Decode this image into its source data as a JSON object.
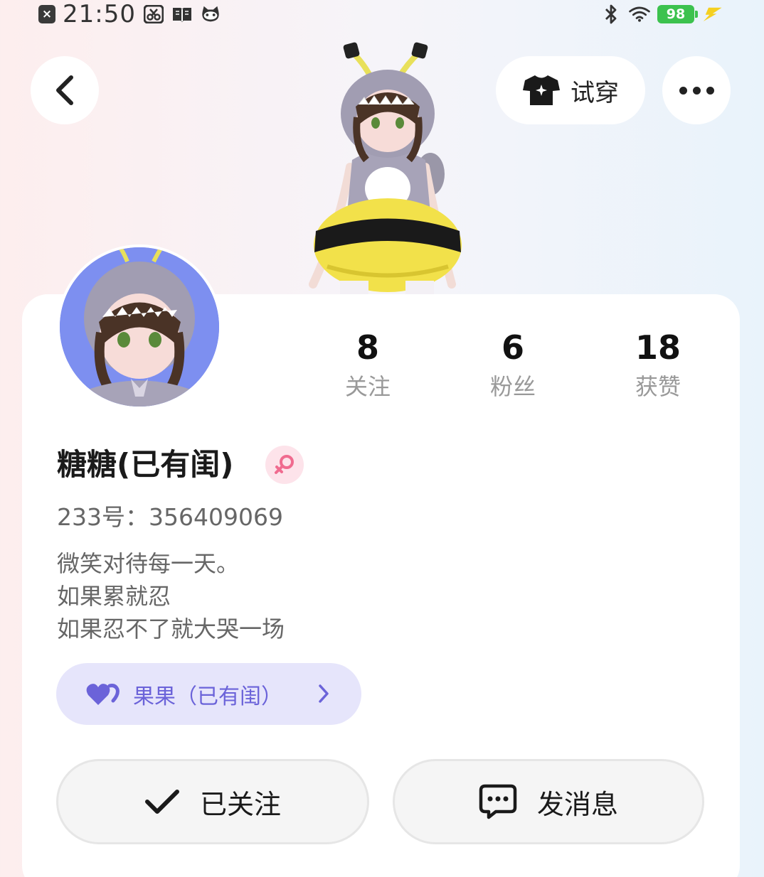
{
  "status_bar": {
    "time": "21:50",
    "battery": "98",
    "icons": [
      "notification-close-icon",
      "scissors-icon",
      "book-icon",
      "cat-icon",
      "bluetooth-icon",
      "wifi-icon",
      "battery-icon",
      "charging-icon"
    ]
  },
  "header": {
    "back_icon": "chevron-left-icon",
    "tryon_label": "试穿",
    "tryon_icon": "shirt-icon",
    "more_icon": "more-dots-icon"
  },
  "profile": {
    "nickname": "糖糖(已有闺)",
    "gender": "female",
    "gender_icon": "female-icon",
    "uid_text": "233号：356409069",
    "bio": [
      "微笑对待每一天。",
      "如果累就忍",
      "如果忍不了就大哭一场"
    ]
  },
  "stats": [
    {
      "value": "8",
      "label": "关注"
    },
    {
      "value": "6",
      "label": "粉丝"
    },
    {
      "value": "18",
      "label": "获赞"
    }
  ],
  "relation": {
    "label": "果果（已有闺）",
    "icon": "hearts-icon",
    "color": "#6b63d9"
  },
  "actions": {
    "follow_label": "已关注",
    "follow_icon": "check-icon",
    "message_label": "发消息",
    "message_icon": "chat-bubble-icon"
  },
  "colors": {
    "battery": "#3cc24e",
    "accent": "#6b63d9",
    "gender_badge": "#fde3ea",
    "gender_symbol": "#f06b8f",
    "avatar_bg": "#7d8ff0"
  }
}
